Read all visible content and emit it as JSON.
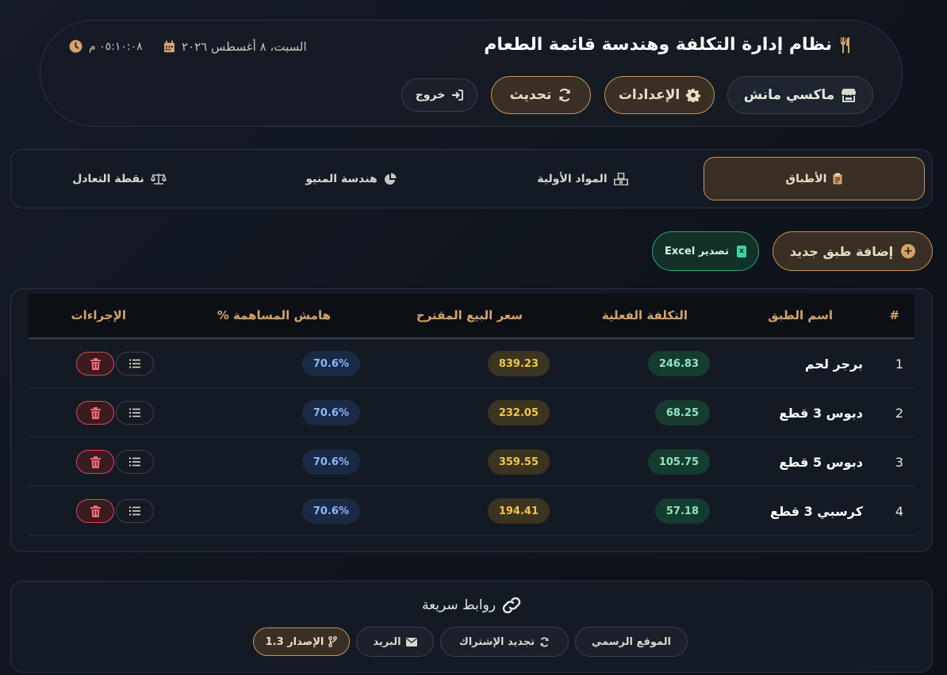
{
  "header": {
    "title": "نظام إدارة التكلفة وهندسة قائمة الطعام",
    "date": "السبت، ٨ أغسطس ٢٠٢٦",
    "time": "٠٥:١٠:٠٨ م",
    "buttons": {
      "store": "ماكسي مانش",
      "settings": "الإعدادات",
      "refresh": "تحديث",
      "logout": "خروج"
    }
  },
  "tabs": [
    {
      "label": "الأطباق",
      "icon": "clipboard-icon",
      "active": true
    },
    {
      "label": "المواد الأولية",
      "icon": "boxes-icon",
      "active": false
    },
    {
      "label": "هندسة المنيو",
      "icon": "pie-chart-icon",
      "active": false
    },
    {
      "label": "نقطة التعادل",
      "icon": "scale-icon",
      "active": false
    }
  ],
  "actions": {
    "add_dish": "إضافة طبق جديد",
    "export": "تصدير Excel"
  },
  "table": {
    "headers": {
      "index": "#",
      "name": "اسم الطبق",
      "cost": "التكلفة الفعلية",
      "price": "سعر البيع المقترح",
      "margin": "هامش المساهمة %",
      "actions": "الإجراءات"
    },
    "rows": [
      {
        "index": "1",
        "name": "برجر لحم",
        "cost": "246.83",
        "price": "839.23",
        "margin": "70.6%"
      },
      {
        "index": "2",
        "name": "دبوس 3 قطع",
        "cost": "68.25",
        "price": "232.05",
        "margin": "70.6%"
      },
      {
        "index": "3",
        "name": "دبوس 5 قطع",
        "cost": "105.75",
        "price": "359.55",
        "margin": "70.6%"
      },
      {
        "index": "4",
        "name": "كرسبي 3 قطع",
        "cost": "57.18",
        "price": "194.41",
        "margin": "70.6%"
      }
    ]
  },
  "footer": {
    "title": "روابط سريعة",
    "links": {
      "website": "الموقع الرسمي",
      "renew": "تجديد الإشتراك",
      "mail": "البريد",
      "version": "الإصدار 1.3"
    }
  },
  "colors": {
    "accent_gold": "#d3a46c",
    "green": "#8fe6c0",
    "yellow": "#f0c64a",
    "blue": "#8db6ff",
    "danger": "#ff6b78"
  }
}
